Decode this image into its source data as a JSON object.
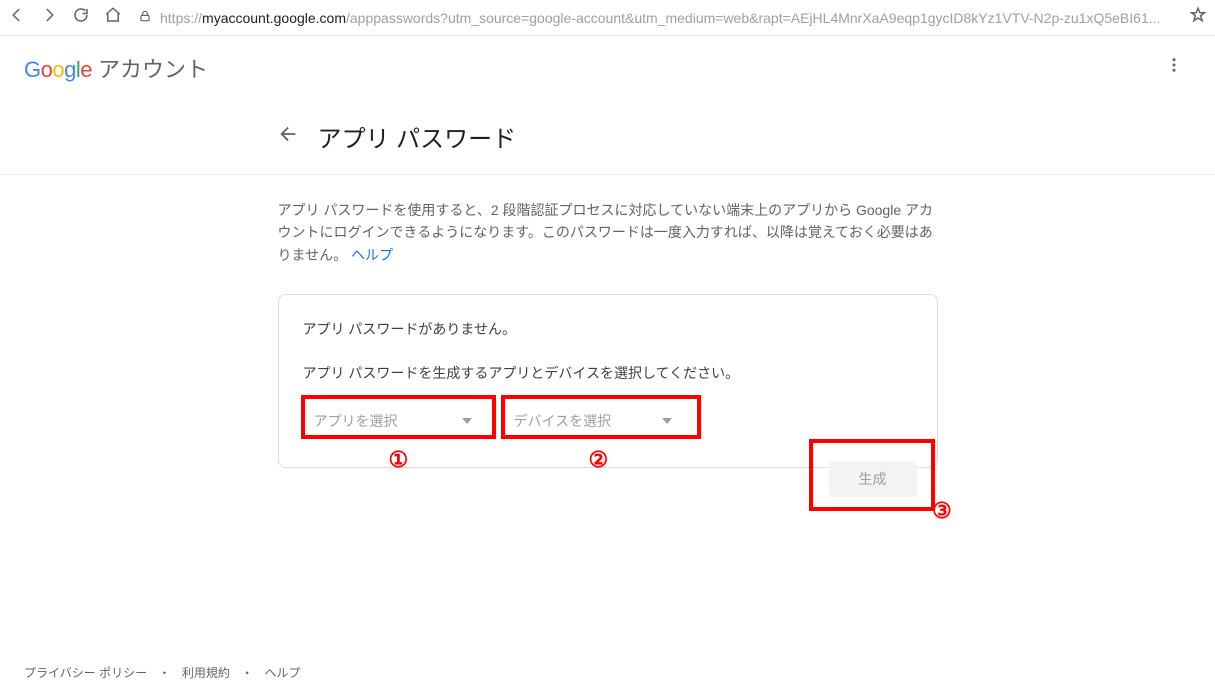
{
  "browser": {
    "url_prefix": "https://",
    "url_host": "myaccount.google.com",
    "url_path": "/apppasswords?utm_source=google-account&utm_medium=web&rapt=AEjHL4MnrXaA9eqp1gycID8kYz1VTV-N2p-zu1xQ5eBI61..."
  },
  "header": {
    "logo_suffix": "アカウント"
  },
  "title": "アプリ パスワード",
  "description": {
    "text": "アプリ パスワードを使用すると、2 段階認証プロセスに対応していない端末上のアプリから Google アカウントにログインできるようになります。このパスワードは一度入力すれば、以降は覚えておく必要はありません。 ",
    "help_label": "ヘルプ"
  },
  "card": {
    "empty_text": "アプリ パスワードがありません。",
    "instruction": "アプリ パスワードを生成するアプリとデバイスを選択してください。",
    "select_app": "アプリを選択",
    "select_device": "デバイスを選択",
    "generate": "生成"
  },
  "annotations": {
    "n1": "①",
    "n2": "②",
    "n3": "③"
  },
  "footer": {
    "privacy": "プライバシー ポリシー",
    "terms": "利用規約",
    "help": "ヘルプ",
    "sep": "・"
  }
}
